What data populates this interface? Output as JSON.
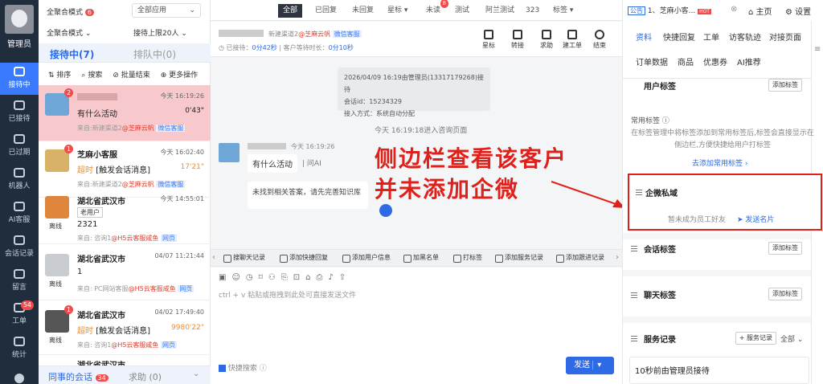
{
  "nav": {
    "role": "管理员",
    "items": [
      {
        "label": "接待中",
        "active": true
      },
      {
        "label": "已接待"
      },
      {
        "label": "已过期"
      },
      {
        "label": "机器人"
      },
      {
        "label": "AI客服"
      },
      {
        "label": "会话记录"
      },
      {
        "label": "留言"
      },
      {
        "label": "工单",
        "badge": "54"
      },
      {
        "label": "统计"
      }
    ]
  },
  "list": {
    "mode_label": "全聚合模式",
    "mode_badge": "6",
    "app_select": "全部应用",
    "mode2": "全聚合模式",
    "limit": "接待上限20人",
    "tab_active": "接待中(7)",
    "tab_queue": "排队中(0)",
    "actions": [
      "排序",
      "搜索",
      "批量结束",
      "更多操作"
    ],
    "items": [
      {
        "name": "",
        "badge": "2",
        "time": "今天 16:19:26",
        "msg": "有什么活动",
        "dur": "0'43\"",
        "from_prefix": "来自:新建渠道2",
        "from_src": "@芝麻云帆",
        "from_tag": "微信客服",
        "offline": ""
      },
      {
        "name": "芝麻小客服",
        "badge": "1",
        "time": "今天 16:02:40",
        "msg_prefix": "超时",
        "msg": "[触发会话消息]",
        "dur": "17'21\"",
        "from_prefix": "来自:新建渠道2",
        "from_src": "@芝麻云帆",
        "from_tag": "微信客服",
        "offline": ""
      },
      {
        "name": "湖北省武汉市",
        "badge": "",
        "time": "今天 14:55:01",
        "old": "老用户",
        "msg": "2321",
        "dur": "",
        "from_prefix": "来自: 咨询1",
        "from_src": "@H5云客服咸鱼",
        "from_tag": "网页",
        "offline": "离线"
      },
      {
        "name": "湖北省武汉市",
        "badge": "",
        "time": "04/07 11:21:44",
        "msg": "1",
        "dur": "",
        "from_prefix": "来自: PC网站客服",
        "from_src": "@H5云客服咸鱼",
        "from_tag": "网页",
        "offline": "离线"
      },
      {
        "name": "湖北省武汉市",
        "badge": "1",
        "time": "04/02 17:49:40",
        "msg_prefix": "超时",
        "msg": "[触发会话消息]",
        "dur": "9980'22\"",
        "from_prefix": "来自: 咨询1",
        "from_src": "@H5云客服咸鱼",
        "from_tag": "网页",
        "offline": "离线"
      }
    ],
    "partial_name": "湖北省武汉市",
    "bottom_tab": "同事的会话",
    "bottom_badge": "34",
    "help_tab": "求助 (0)"
  },
  "center": {
    "tabs": [
      {
        "label": "全部",
        "on": true
      },
      {
        "label": "已回复"
      },
      {
        "label": "未回复"
      },
      {
        "label": "星标 ▾"
      },
      {
        "label": "未读",
        "badge": "8"
      },
      {
        "label": "测试"
      },
      {
        "label": "阿兰测试"
      },
      {
        "label": "323"
      },
      {
        "label": "标签 ▾"
      }
    ],
    "channel": "新建渠道2",
    "channel_src": "@芝麻云帆",
    "channel_tag": "微信客服",
    "waited": "已接待：",
    "waited_val": "0分42秒",
    "visit": "客户等待时长：",
    "visit_val": "0分10秒",
    "tools": [
      "星标",
      "转接",
      "求助",
      "建工单",
      "结束"
    ],
    "sys_line1": "2026/04/09 16:19由管理员(13317179268)接待",
    "sys_line2": "会话id：15234329",
    "sys_line3": "接入方式：系统自动分配",
    "entered": "今天 16:19:18进入咨询页面",
    "msg_time": "今天 16:19:26",
    "msg_text": "有什么活动",
    "msg_ai": "问AI",
    "reply": "未找到相关答案，请先完善知识库",
    "annotation_line1": "侧边栏查看该客户",
    "annotation_line2": "并未添加企微",
    "chips": [
      "搜聊天记录",
      "添加快捷回复",
      "添加用户信息",
      "加黑名单",
      "打标签",
      "添加服务记录",
      "添加跟进记录"
    ],
    "placeholder": "ctrl + v 粘贴或拖拽到此处可直接发送文件",
    "quick_search": "快捷搜索",
    "send": "发送"
  },
  "right": {
    "notice_tag": "公告",
    "notice": "1、芝麻小客...",
    "home": "主页",
    "settings": "设置",
    "tabs": [
      "资料",
      "快捷回复",
      "工单",
      "访客轨迹",
      "对接页面"
    ],
    "tabs2": [
      "订单数据",
      "商品",
      "优惠券",
      "AI推荐"
    ],
    "user_tags": "用户标签",
    "add_tag": "添加标签",
    "common_tags": "常用标签",
    "common_desc": "在标签管理中将标签添加到常用标签后,标签会直接显示在侧边栏,方便快捷给用户打标签",
    "go_add": "去添加常用标签",
    "wecom_title": "企微私域",
    "wecom_state": "暂未成为员工好友",
    "send_card": "发送名片",
    "session_tags": "会话标签",
    "chat_tags": "聊天标签",
    "service_records": "服务记录",
    "service_btn": "+ 服务记录",
    "service_all": "全部",
    "service_first": "10秒前由管理员接待"
  }
}
